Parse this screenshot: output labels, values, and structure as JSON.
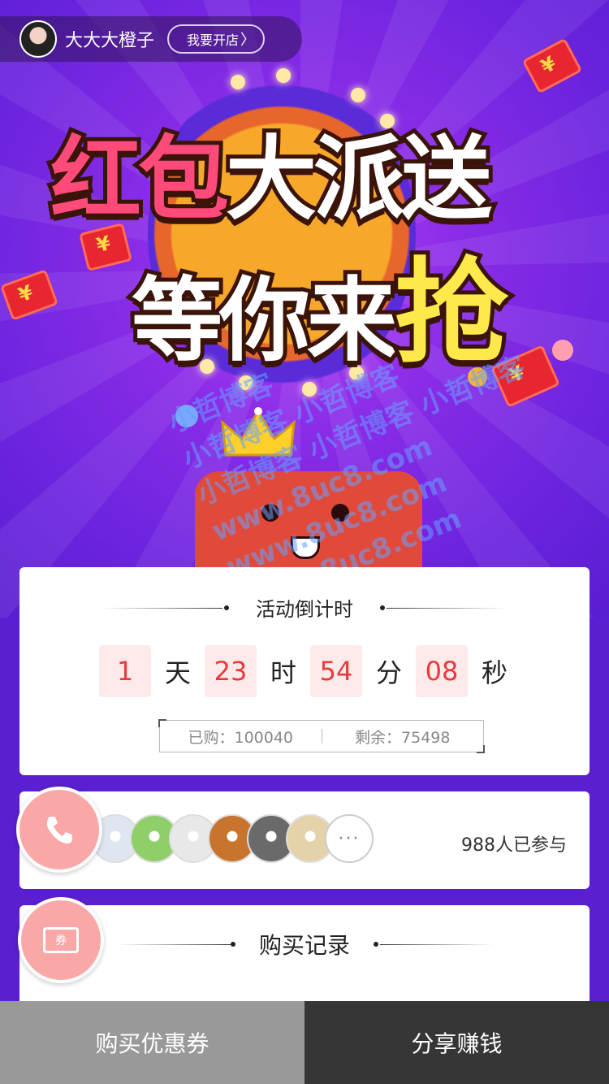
{
  "header": {
    "shop_name": "大大大橙子",
    "open_shop_label": "我要开店",
    "open_shop_chevron": "〉"
  },
  "banner": {
    "title_line1_a": "红包",
    "title_line1_b": "大派送",
    "title_line2_a": "等你来",
    "title_line2_b": "抢",
    "watermark_lines": [
      "小哲博客",
      "小哲博客 小哲博客",
      "小哲博客 小哲博客 小哲博客",
      "www.8uc8.com",
      "www.8uc8.com",
      "www.8uc8.com"
    ]
  },
  "countdown": {
    "title": "活动倒计时",
    "days": "1",
    "days_unit": "天",
    "hours": "23",
    "hours_unit": "时",
    "minutes": "54",
    "minutes_unit": "分",
    "seconds": "08",
    "seconds_unit": "秒",
    "purchased_label": "已购：100040",
    "remaining_label": "剩余：75498"
  },
  "participants": {
    "count_label": "988人已参与",
    "more_label": "···",
    "avatar_colors": [
      "#dfe6f2",
      "#8fcf6a",
      "#e8e8e8",
      "#c9742c",
      "#6a6a6a",
      "#e6d2a8"
    ]
  },
  "records": {
    "title": "购买记录"
  },
  "float_buttons": {
    "coupon_icon_text": "券"
  },
  "bottom_bar": {
    "buy_coupon_label": "购买优惠券",
    "share_label": "分享赚钱"
  },
  "colors": {
    "accent_red": "#e83a3a",
    "float_pink": "#f9a7a7",
    "bottom_gray": "#999999",
    "bottom_dark": "#363636"
  }
}
